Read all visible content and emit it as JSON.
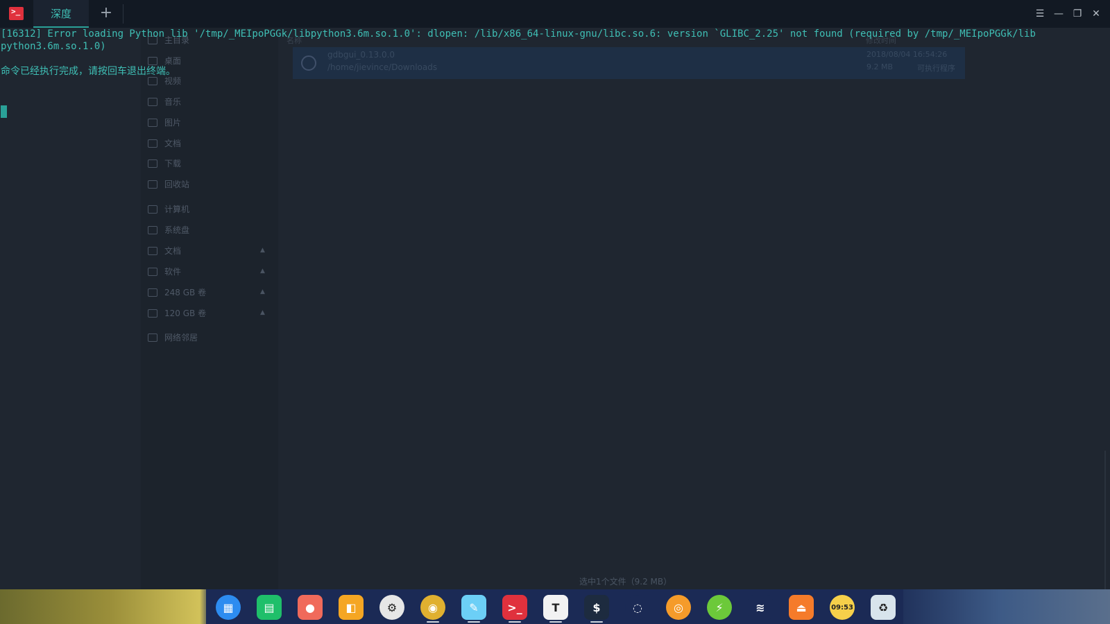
{
  "window": {
    "tab_label": "深度",
    "new_tab_symbol": "+",
    "menu_symbol": "☰",
    "minimize_symbol": "—",
    "maximize_symbol": "❐",
    "close_symbol": "✕",
    "app_icon_glyph": ">_"
  },
  "terminal": {
    "lines": [
      "[16312] Error loading Python lib '/tmp/_MEIpoPGGk/libpython3.6m.so.1.0': dlopen: /lib/x86_64-linux-gnu/libc.so.6: version `GLIBC_2.25' not found (required by /tmp/_MEIpoPGGk/lib",
      "python3.6m.so.1.0)",
      "",
      "命令已经执行完成，请按回车退出终端。"
    ]
  },
  "file_manager_background": {
    "sidebar": [
      {
        "label": "主目录"
      },
      {
        "label": "桌面"
      },
      {
        "label": "视频"
      },
      {
        "label": "音乐"
      },
      {
        "label": "图片"
      },
      {
        "label": "文档"
      },
      {
        "label": "下载"
      },
      {
        "label": "回收站"
      },
      {
        "label": "计算机"
      },
      {
        "label": "系统盘"
      },
      {
        "label": "文档"
      },
      {
        "label": "软件"
      },
      {
        "label": "248 GB 卷"
      },
      {
        "label": "120 GB 卷"
      },
      {
        "label": "网络邻居"
      }
    ],
    "column_header": "名称",
    "column_header_modified": "修改时间",
    "file": {
      "name": "gdbgui_0.13.0.0",
      "path": "/home/jievince/Downloads",
      "date": "2018/08/04 16:54:26",
      "size": "9.2 MB",
      "type": "可执行程序"
    },
    "status": "选中1个文件（9.2 MB）"
  },
  "dock": {
    "items": [
      {
        "name": "launcher",
        "glyph": "▦",
        "color": "#2d8cf0"
      },
      {
        "name": "file-manager",
        "glyph": "▤",
        "color": "#1fbf6a"
      },
      {
        "name": "screen-recorder",
        "glyph": "●",
        "color": "#f06a5b"
      },
      {
        "name": "app-store",
        "glyph": "◧",
        "color": "#f5a623"
      },
      {
        "name": "settings",
        "glyph": "⚙",
        "color": "#e6e6e6"
      },
      {
        "name": "chrome",
        "glyph": "◉",
        "color": "#e0b030"
      },
      {
        "name": "text-editor",
        "glyph": "✎",
        "color": "#6ccff6"
      },
      {
        "name": "terminal",
        "glyph": ">_",
        "color": "#e0313d"
      },
      {
        "name": "typora",
        "glyph": "T",
        "color": "#f2f2f2"
      },
      {
        "name": "shell",
        "glyph": "$",
        "color": "#1d2b3f"
      },
      {
        "name": "screenshot",
        "glyph": "◌",
        "color": "#1b2a55"
      },
      {
        "name": "browser",
        "glyph": "◎",
        "color": "#f59b2a"
      },
      {
        "name": "power",
        "glyph": "⚡",
        "color": "#6cc93a"
      },
      {
        "name": "wifi",
        "glyph": "≋",
        "color": "#1b2a55"
      },
      {
        "name": "eject",
        "glyph": "⏏",
        "color": "#f57b2a"
      },
      {
        "name": "clock",
        "glyph": "09:53",
        "color": "#f6d04a"
      },
      {
        "name": "trash",
        "glyph": "♻",
        "color": "#d8e4ec"
      }
    ]
  }
}
